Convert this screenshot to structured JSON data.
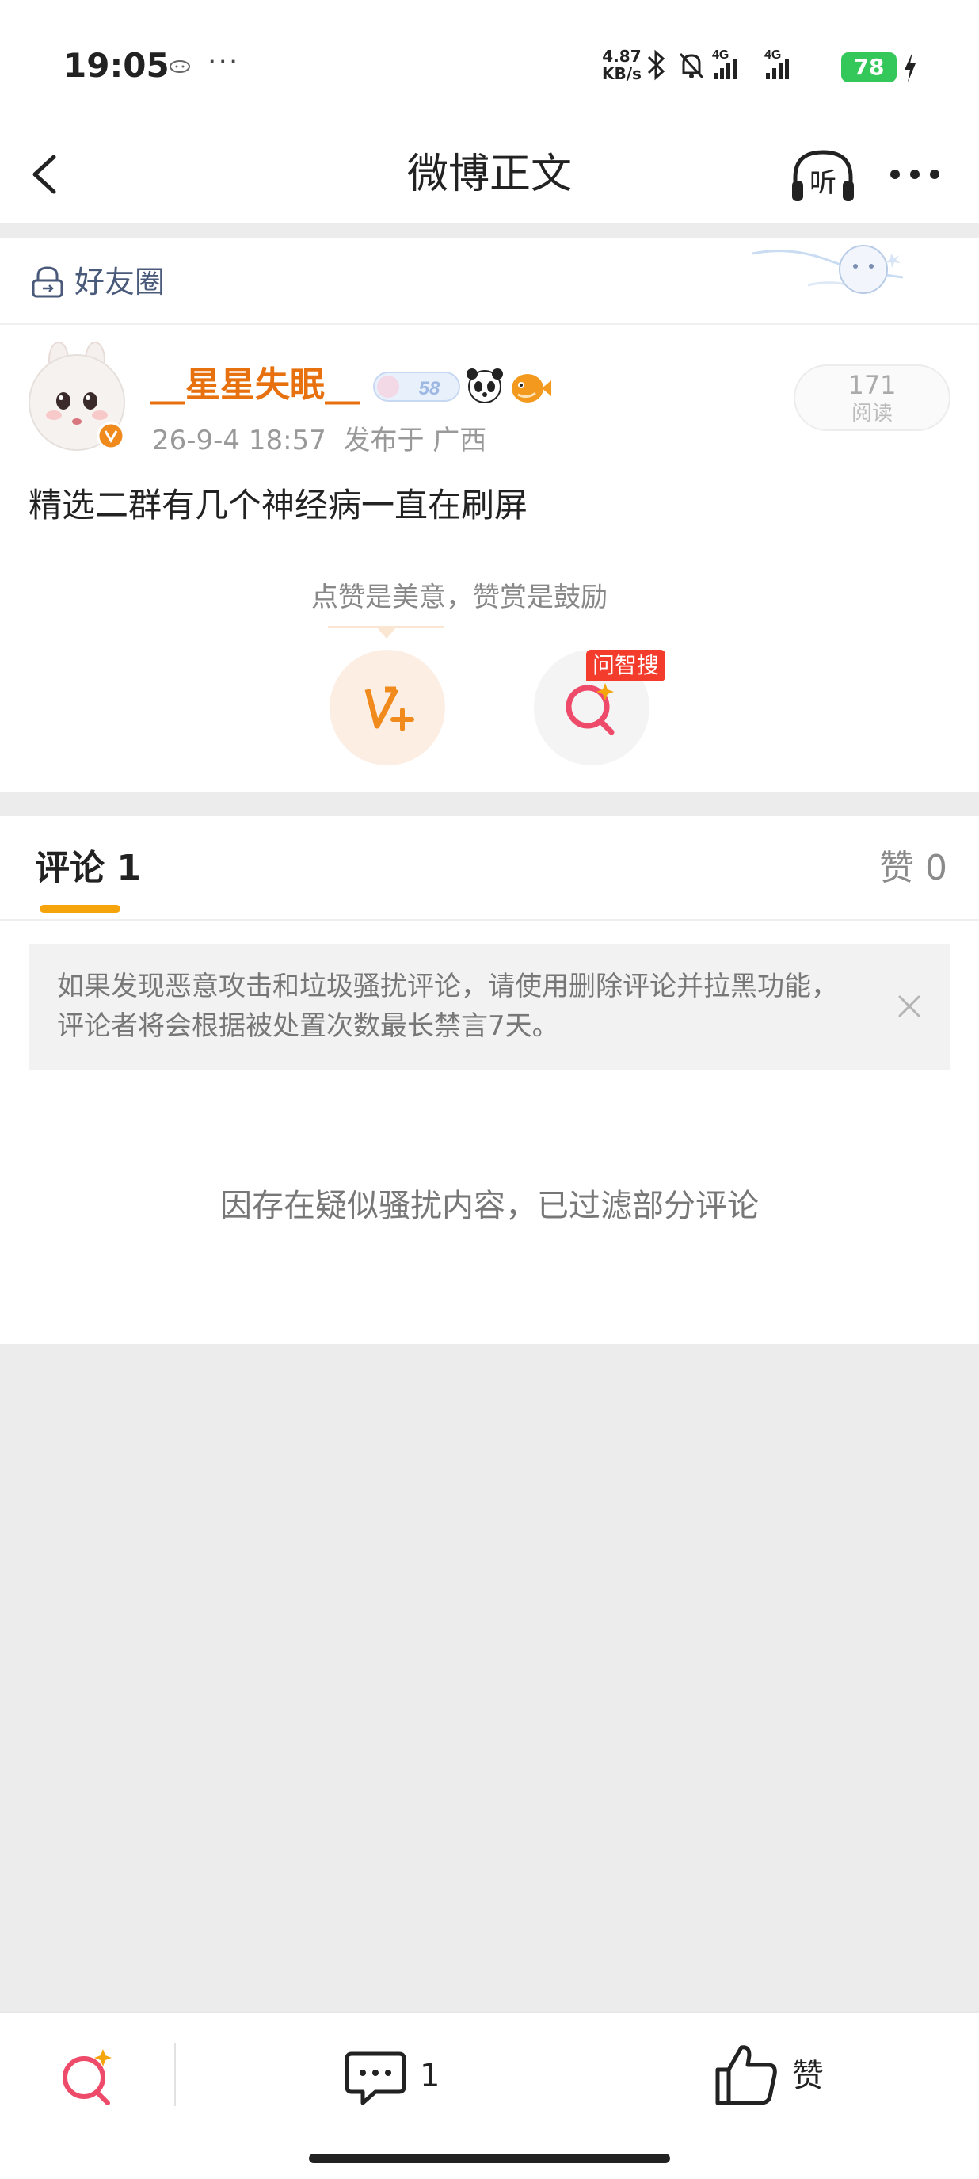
{
  "status_bar": {
    "time": "19:05",
    "more": "···",
    "net_speed_value": "4.87",
    "net_speed_unit": "KB/s",
    "signal_1": "4G",
    "signal_2": "4G",
    "battery": "78",
    "battery_color": "#34c759"
  },
  "navbar": {
    "title": "微博正文",
    "listen_label": "听"
  },
  "friend_circle": {
    "label": "好友圈"
  },
  "post": {
    "username": "__星星失眠__",
    "level_badge": "58",
    "timestamp": "26-9-4 18:57",
    "location_prefix": "发布于",
    "location": "广西",
    "read_count": "171",
    "read_label": "阅读",
    "content": "精选二群有几个神经病一直在刷屏",
    "encourage_text": "点赞是美意，赞赏是鼓励",
    "search_tag": "问智搜",
    "username_color": "#e8710f"
  },
  "tabs": {
    "comment_label": "评论",
    "comment_count": "1",
    "like_label": "赞",
    "like_count": "0",
    "accent_color": "#f5a40c"
  },
  "notice": {
    "line1": "如果发现恶意攻击和垃圾骚扰评论，请使用删除评论并拉黑功能，",
    "line2": "评论者将会根据被处置次数最长禁言7天。"
  },
  "filtered_message": "因存在疑似骚扰内容，已过滤部分评论",
  "bottom_bar": {
    "comment_count": "1",
    "like_label": "赞"
  }
}
